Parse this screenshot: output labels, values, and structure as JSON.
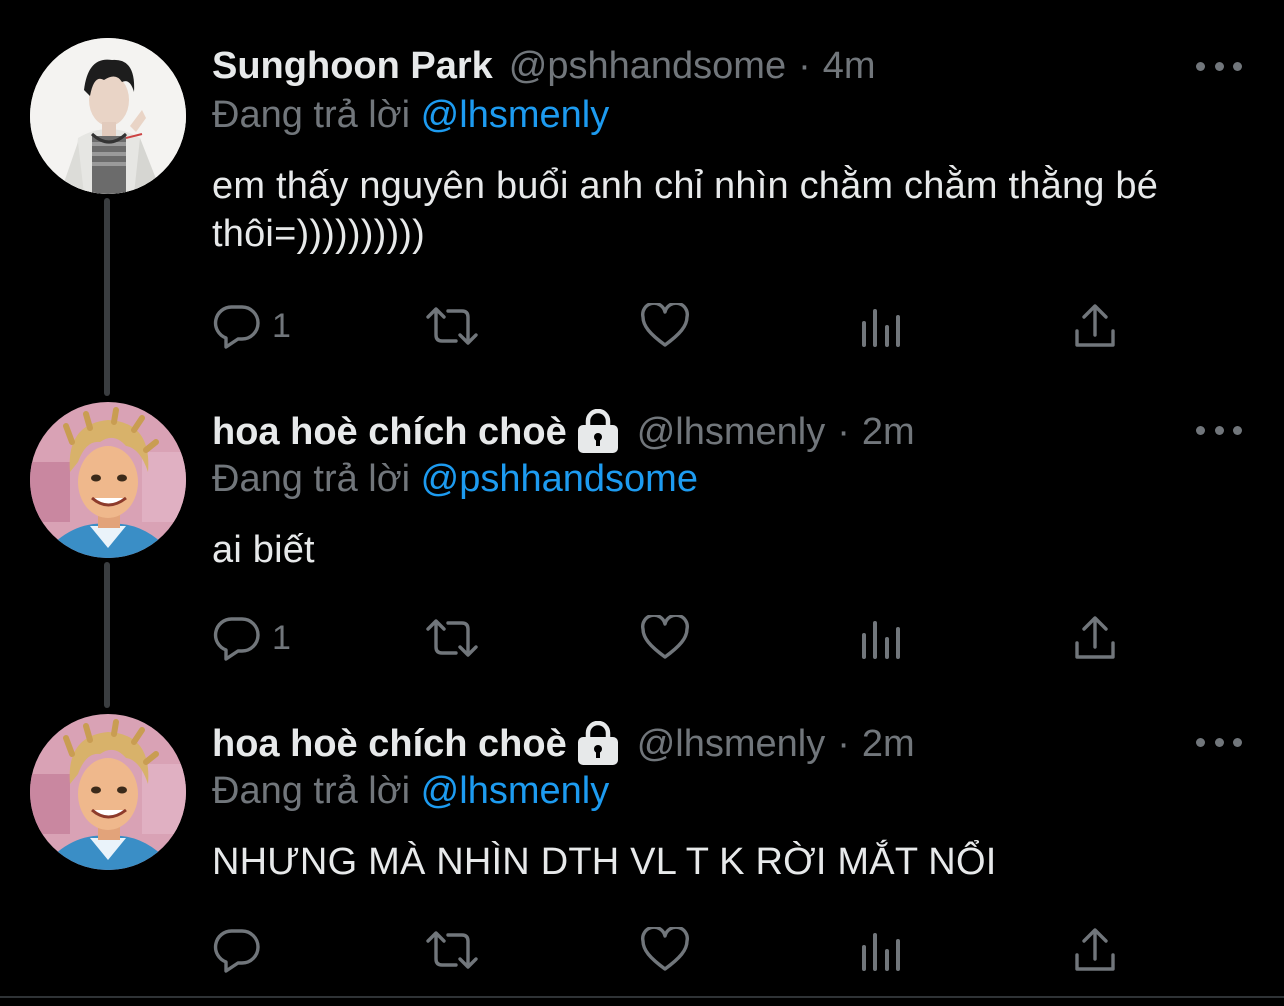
{
  "thread": {
    "tweets": [
      {
        "name": "Sunghoon Park",
        "handle": "@pshhandsome",
        "separator": "·",
        "time": "4m",
        "protected": false,
        "reply_prefix": "Đang trả lời",
        "reply_to": "@lhsmenly",
        "text": "em thấy nguyên buổi anh chỉ nhìn chằm chằm thằng bé thôi=))))))))))",
        "reply_count": "1"
      },
      {
        "name": "hoa hoè chích choè",
        "handle": "@lhsmenly",
        "separator": "·",
        "time": "2m",
        "protected": true,
        "reply_prefix": "Đang trả lời",
        "reply_to": "@pshhandsome",
        "text": "ai biết",
        "reply_count": "1"
      },
      {
        "name": "hoa hoè chích choè",
        "handle": "@lhsmenly",
        "separator": "·",
        "time": "2m",
        "protected": true,
        "reply_prefix": "Đang trả lời",
        "reply_to": "@lhsmenly",
        "text": "NHƯNG MÀ NHÌN DTH VL T K RỜI MẮT NỔI",
        "reply_count": ""
      }
    ]
  },
  "icons": {
    "reply": "reply-bubble-icon",
    "retweet": "retweet-icon",
    "like": "heart-icon",
    "views": "analytics-icon",
    "share": "share-icon",
    "more": "more-dots-icon",
    "protected": "lock-icon"
  },
  "colors": {
    "background": "#000000",
    "primary_text": "#e7e9ea",
    "secondary_text": "#71767b",
    "mention": "#1d9bf0",
    "thread_line": "#3a3d40"
  }
}
